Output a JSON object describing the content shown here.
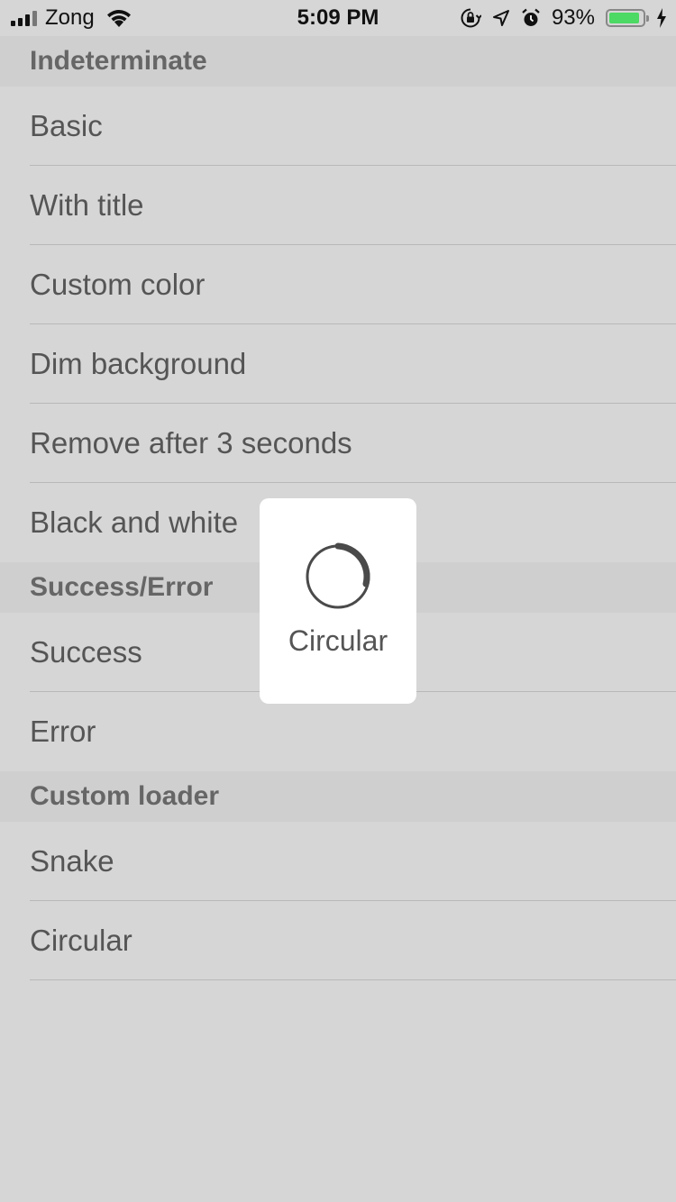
{
  "status_bar": {
    "carrier": "Zong",
    "time": "5:09 PM",
    "battery_percent": "93%",
    "battery_level": 0.93,
    "icons": [
      "signal-icon",
      "wifi-icon",
      "orientation-lock-icon",
      "location-icon",
      "alarm-icon",
      "battery-icon",
      "charging-icon"
    ]
  },
  "sections": [
    {
      "header": "Indeterminate",
      "items": [
        "Basic",
        "With title",
        "Custom color",
        "Dim background",
        "Remove after 3 seconds",
        "Black and white"
      ]
    },
    {
      "header": "Success/Error",
      "items": [
        "Success",
        "Error"
      ]
    },
    {
      "header": "Custom loader",
      "items": [
        "Snake",
        "Circular"
      ]
    }
  ],
  "hud": {
    "label": "Circular",
    "icon": "circular-spinner-icon"
  },
  "colors": {
    "background": "#d6d6d6",
    "section_header": "#cfcfcf",
    "text": "#555555",
    "battery": "#4cd964",
    "hud_background": "#ffffff"
  }
}
